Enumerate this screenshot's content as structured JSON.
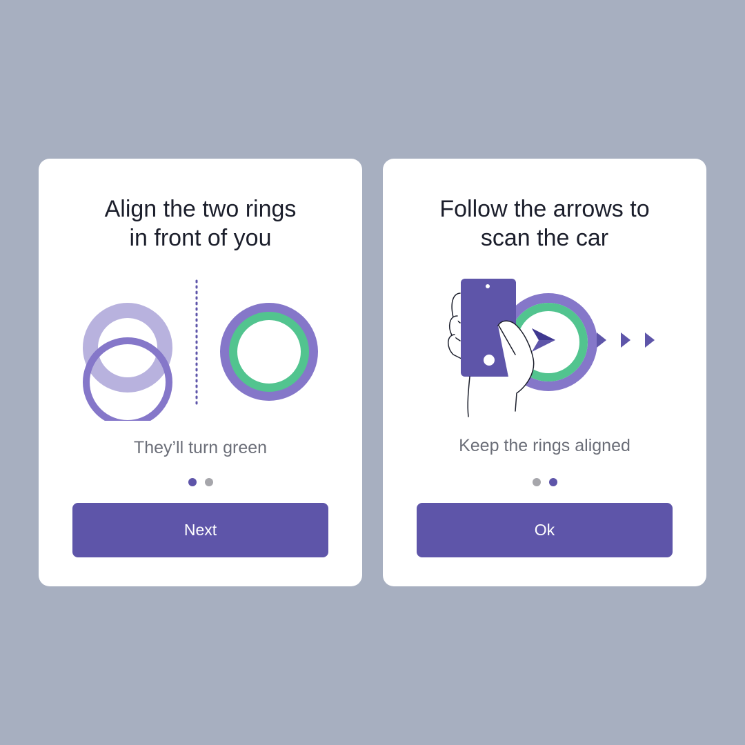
{
  "colors": {
    "background": "#a7afc0",
    "card": "#ffffff",
    "primary": "#5e55a9",
    "ring_purple": "#8577c9",
    "ring_light": "#b8b2de",
    "ring_green": "#52c48f",
    "text_dark": "#1b1e2b",
    "text_muted": "#6b6e78",
    "dot_inactive": "#a6a6ab"
  },
  "steps": [
    {
      "title_lines": [
        "Align the two rings",
        "in front of you"
      ],
      "subtitle": "They’ll turn green",
      "illustration_icon": "rings-alignment-icon",
      "dots": {
        "count": 2,
        "active_index": 0
      },
      "button_label": "Next"
    },
    {
      "title_lines": [
        "Follow the arrows to",
        "scan the car"
      ],
      "subtitle": "Keep the rings aligned",
      "illustration_icon": "phone-scan-arrows-icon",
      "dots": {
        "count": 2,
        "active_index": 1
      },
      "button_label": "Ok"
    }
  ]
}
